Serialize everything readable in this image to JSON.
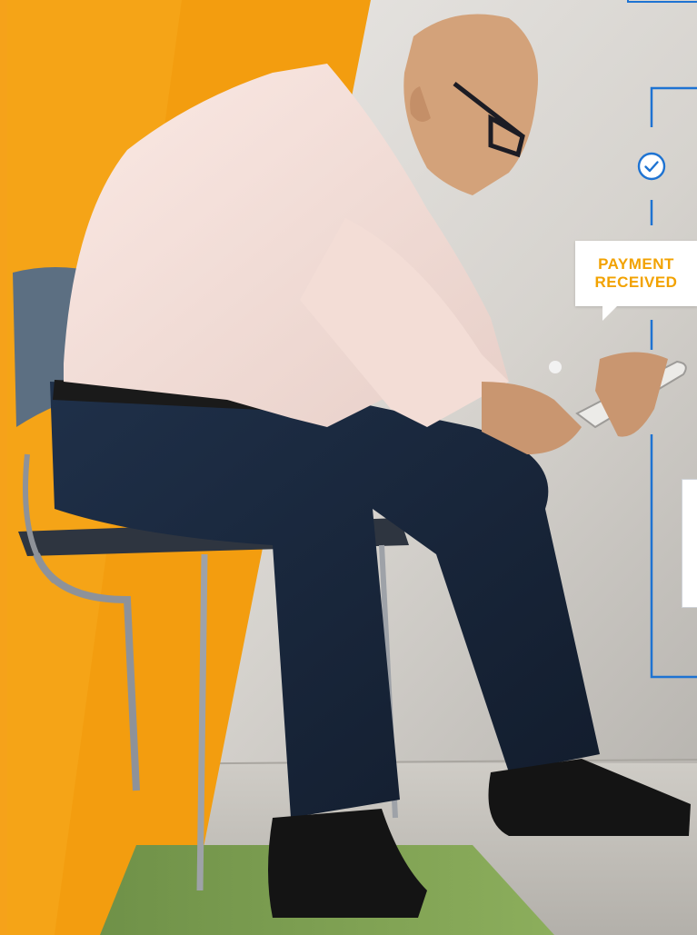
{
  "callout": {
    "line1": "PAYMENT",
    "line2": "RECEIVED"
  },
  "colors": {
    "accent_orange": "#f2a200",
    "flow_blue": "#1e73d2",
    "card_white": "#ffffff"
  },
  "icons": [
    "check-circle-icon"
  ]
}
